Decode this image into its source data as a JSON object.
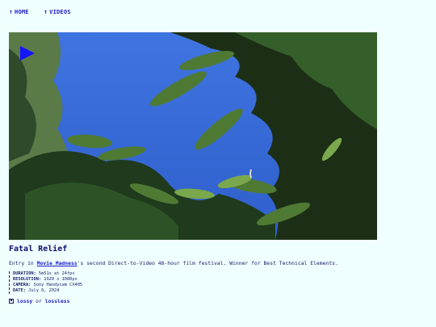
{
  "nav": {
    "home_label": "HOME",
    "videos_label": "VIDEOS"
  },
  "video": {
    "play_icon": "play-icon"
  },
  "film": {
    "title": "Fatal Relief",
    "desc_prefix": "Entry in ",
    "desc_org": "Movie Madness",
    "desc_suffix": "'s second Direct-to-Video 48-hour film festival. Winner for Best Technical Elements."
  },
  "meta": {
    "duration_label": "DURATION:",
    "duration_value": "5m51s at 24fps",
    "resolution_label": "RESOLUTION:",
    "resolution_value": "1920 x 1080px",
    "camera_label": "CAMERA:",
    "camera_value": "Sony Handycam CX405",
    "date_label": "DATE:",
    "date_value": "July 6, 2024"
  },
  "downloads": {
    "icon": "floppy-disk-icon",
    "lossy_label": "lossy",
    "or_label": "or",
    "lossless_label": "lossless"
  },
  "colors": {
    "background": "#f0ffff",
    "link": "#1a1acc",
    "text": "#1a1a66"
  }
}
